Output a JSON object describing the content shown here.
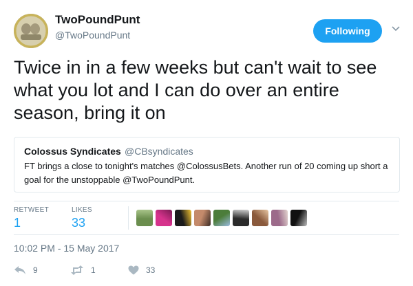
{
  "author": {
    "name": "TwoPoundPunt",
    "handle": "@TwoPoundPunt"
  },
  "follow_button": {
    "label": "Following"
  },
  "tweet": {
    "text": "Twice in in a few weeks but can't wait to see what you lot and I can do over an entire season, bring it on"
  },
  "quoted_tweet": {
    "name": "Colossus Syndicates",
    "handle": "@CBsyndicates",
    "text": "FT brings a close to tonight's matches @ColossusBets. Another run of 20 coming up short a goal for the unstoppable @TwoPoundPunt."
  },
  "stats": {
    "retweets_label": "RETWEET",
    "retweets_value": "1",
    "likes_label": "LIKES",
    "likes_value": "33"
  },
  "likers": [
    {
      "name": "liker-1",
      "colors": [
        "#6b8e4e",
        "#a9c48a"
      ]
    },
    {
      "name": "liker-2",
      "colors": [
        "#d6338c",
        "#7a1a52"
      ]
    },
    {
      "name": "liker-3",
      "colors": [
        "#1b1b1b",
        "#f2c230"
      ]
    },
    {
      "name": "liker-4",
      "colors": [
        "#c48a6b",
        "#3a2a24"
      ]
    },
    {
      "name": "liker-5",
      "colors": [
        "#4c7d3a",
        "#9bbbe0"
      ]
    },
    {
      "name": "liker-6",
      "colors": [
        "#2b2b2b",
        "#d0d0d0"
      ]
    },
    {
      "name": "liker-7",
      "colors": [
        "#8a5a3c",
        "#e8c7a3"
      ]
    },
    {
      "name": "liker-8",
      "colors": [
        "#9c6a8a",
        "#e3d4cf"
      ]
    },
    {
      "name": "liker-9",
      "colors": [
        "#111111",
        "#bdbdbd"
      ]
    }
  ],
  "timestamp": "10:02 PM - 15 May 2017",
  "actions": {
    "reply_count": "9",
    "retweet_count": "1",
    "like_count": "33"
  },
  "colors": {
    "accent": "#1da1f2",
    "secondary_text": "#657786",
    "border": "#e1e8ed",
    "primary_text": "#14171a"
  }
}
